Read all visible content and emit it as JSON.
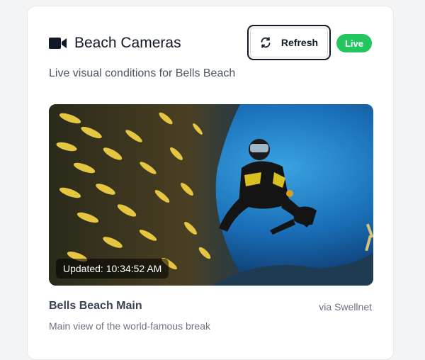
{
  "header": {
    "title": "Beach Cameras",
    "title_icon": "video-camera-icon",
    "refresh_label": "Refresh",
    "refresh_icon": "refresh-icon",
    "live_badge": "Live"
  },
  "subtitle": "Live visual conditions for Bells Beach",
  "camera": {
    "updated": "Updated: 10:34:52 AM",
    "name": "Bells Beach Main",
    "source": "via Swellnet",
    "description": "Main view of the world-famous break"
  },
  "colors": {
    "live_badge": "#22c55e",
    "title_text": "#111827",
    "muted_text": "#6b7280"
  }
}
